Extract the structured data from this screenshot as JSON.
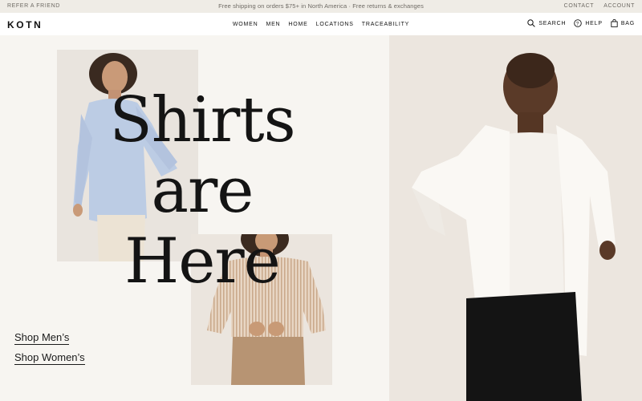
{
  "announcement": {
    "left": "REFER A FRIEND",
    "center": "Free shipping on orders $75+ in North America · Free returns & exchanges",
    "right": [
      "CONTACT",
      "ACCOUNT"
    ]
  },
  "nav": {
    "logo": "KOTN",
    "links": [
      "WOMEN",
      "MEN",
      "HOME",
      "LOCATIONS",
      "TRACEABILITY"
    ],
    "actions": [
      {
        "label": "SEARCH",
        "icon": "search-icon"
      },
      {
        "label": "HELP",
        "icon": "help-icon"
      },
      {
        "label": "BAG",
        "icon": "bag-icon"
      }
    ]
  },
  "hero": {
    "headline": [
      "Shirts",
      "are",
      "Here"
    ],
    "cta_men": "Shop Men’s",
    "cta_women": "Shop Women’s",
    "images": [
      "woman in light blue shirt",
      "woman in striped shirt",
      "man in white shirt"
    ]
  },
  "colors": {
    "background": "#f7f5f1",
    "announcement_bar": "#efece6",
    "text": "#1a1a1a"
  }
}
